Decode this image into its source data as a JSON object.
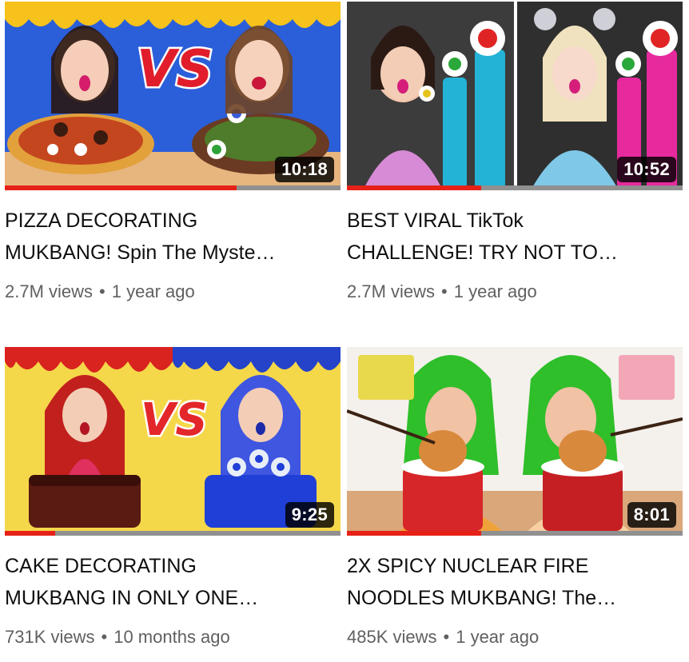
{
  "colors": {
    "progress": "#e62117",
    "track": "#909090",
    "meta_text": "#606060"
  },
  "videos": [
    {
      "duration": "10:18",
      "progress": 0.69,
      "title_line1": "PIZZA DECORATING",
      "title_line2": "MUKBANG! Spin The Myste…",
      "views": "2.7M views",
      "age": "1 year ago",
      "overlay_text": "VS"
    },
    {
      "duration": "10:52",
      "progress": 0.4,
      "title_line1": "BEST VIRAL TikTok",
      "title_line2": "CHALLENGE! TRY NOT TO…",
      "views": "2.7M views",
      "age": "1 year ago"
    },
    {
      "duration": "9:25",
      "progress": 0.15,
      "title_line1": "CAKE DECORATING",
      "title_line2": "MUKBANG IN ONLY ONE…",
      "views": "731K views",
      "age": "10 months ago",
      "overlay_text": "VS"
    },
    {
      "duration": "8:01",
      "progress": 0.4,
      "title_line1": "2X SPICY NUCLEAR FIRE",
      "title_line2": "NOODLES MUKBANG! The…",
      "views": "485K views",
      "age": "1 year ago"
    }
  ]
}
